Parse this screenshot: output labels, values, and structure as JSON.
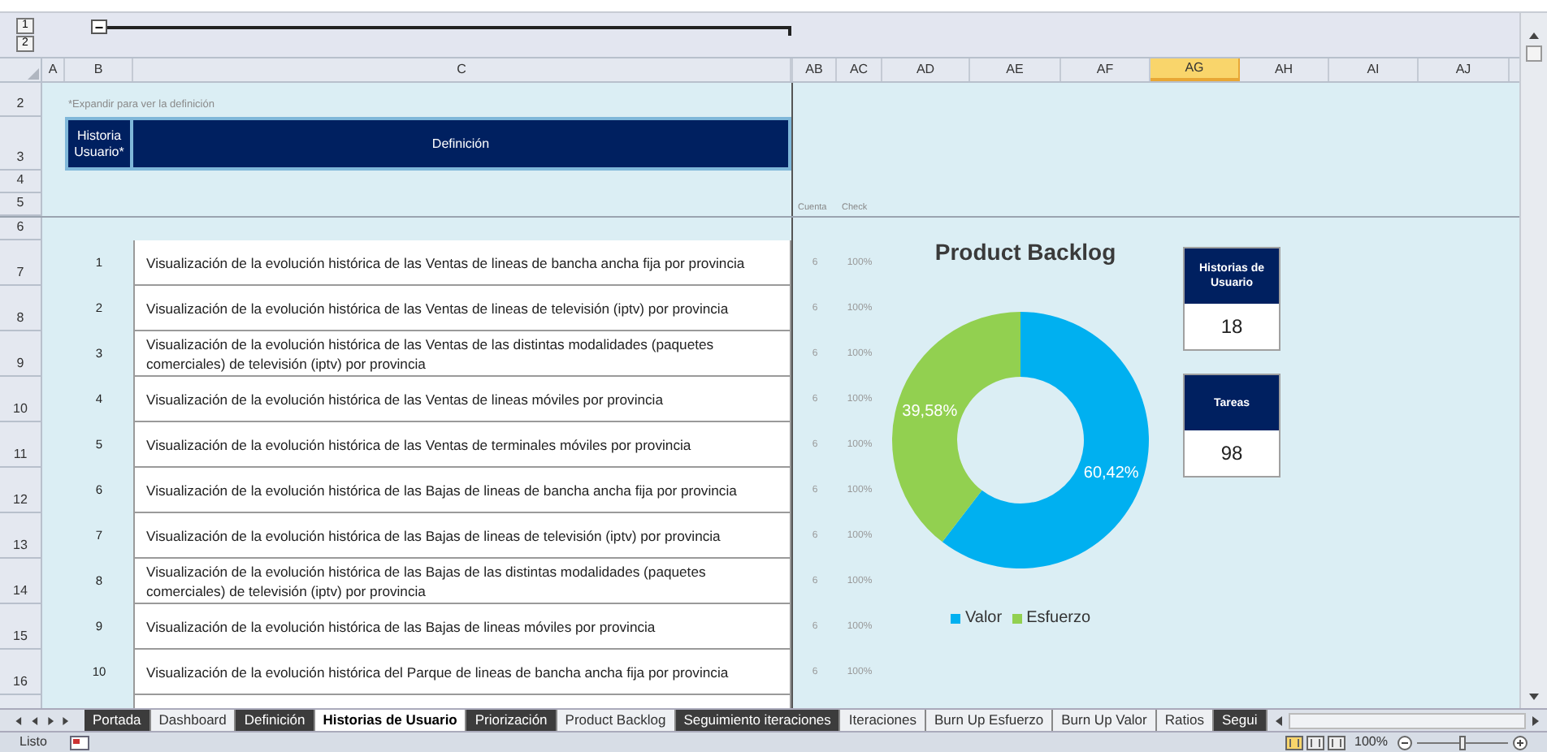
{
  "outline": {
    "levels": [
      "1",
      "2"
    ],
    "collapse": "−"
  },
  "columns": [
    {
      "label": "A",
      "selected": false
    },
    {
      "label": "B",
      "selected": false
    },
    {
      "label": "C",
      "selected": false
    },
    {
      "label": "AB",
      "selected": false
    },
    {
      "label": "AC",
      "selected": false
    },
    {
      "label": "AD",
      "selected": false
    },
    {
      "label": "AE",
      "selected": false
    },
    {
      "label": "AF",
      "selected": false
    },
    {
      "label": "AG",
      "selected": true
    },
    {
      "label": "AH",
      "selected": false
    },
    {
      "label": "AI",
      "selected": false
    },
    {
      "label": "AJ",
      "selected": false
    }
  ],
  "rows": [
    {
      "number": "2",
      "kind": "note",
      "text": "*Expandir para ver la definición"
    },
    {
      "number": "3",
      "kind": "header",
      "id_heading": "Historia Usuario*",
      "definition_heading": "Definición"
    },
    {
      "number": "4",
      "kind": "blank"
    },
    {
      "number": "5",
      "kind": "labels",
      "cuenta": "Cuenta",
      "check": "Check"
    },
    {
      "number": "6",
      "kind": "blank"
    },
    {
      "number": "7",
      "kind": "story",
      "id": "1",
      "definition": "Visualización de la evolución histórica de las Ventas de lineas de bancha ancha fija por provincia",
      "cuenta": "6",
      "check": "100%"
    },
    {
      "number": "8",
      "kind": "story",
      "id": "2",
      "definition": "Visualización de la evolución histórica de las Ventas de lineas de televisión (iptv) por provincia",
      "cuenta": "6",
      "check": "100%"
    },
    {
      "number": "9",
      "kind": "story",
      "id": "3",
      "definition": "Visualización de la evolución histórica de las Ventas de las distintas modalidades (paquetes comerciales) de televisión (iptv) por provincia",
      "cuenta": "6",
      "check": "100%"
    },
    {
      "number": "10",
      "kind": "story",
      "id": "4",
      "definition": "Visualización de la evolución histórica de las Ventas de lineas móviles por provincia",
      "cuenta": "6",
      "check": "100%"
    },
    {
      "number": "11",
      "kind": "story",
      "id": "5",
      "definition": "Visualización de la evolución histórica de las Ventas de terminales móviles por provincia",
      "cuenta": "6",
      "check": "100%"
    },
    {
      "number": "12",
      "kind": "story",
      "id": "6",
      "definition": "Visualización de la evolución histórica de las Bajas de lineas de bancha ancha fija por provincia",
      "cuenta": "6",
      "check": "100%"
    },
    {
      "number": "13",
      "kind": "story",
      "id": "7",
      "definition": "Visualización de la evolución histórica de las Bajas de lineas de televisión (iptv) por provincia",
      "cuenta": "6",
      "check": "100%"
    },
    {
      "number": "14",
      "kind": "story",
      "id": "8",
      "definition": "Visualización de la evolución histórica de las Bajas de las distintas modalidades (paquetes comerciales) de televisión (iptv) por provincia",
      "cuenta": "6",
      "check": "100%"
    },
    {
      "number": "15",
      "kind": "story",
      "id": "9",
      "definition": "Visualización de la evolución histórica de las Bajas de lineas móviles por provincia",
      "cuenta": "6",
      "check": "100%"
    },
    {
      "number": "16",
      "kind": "story",
      "id": "10",
      "definition": "Visualización de la evolución histórica del Parque de lineas de bancha ancha fija por provincia",
      "cuenta": "6",
      "check": "100%"
    }
  ],
  "chart": {
    "chart_data": {
      "type": "donut",
      "title": "Product Backlog",
      "categories": [
        "Valor",
        "Esfuerzo"
      ],
      "values": [
        60.42,
        39.58
      ],
      "colors": [
        "#00b0f0",
        "#92d050"
      ],
      "value_labels": [
        "60,42%",
        "39,58%"
      ],
      "legend": "bottom"
    }
  },
  "kpis": [
    {
      "label": "Historias de Usuario",
      "value": "18"
    },
    {
      "label": "Tareas",
      "value": "98"
    }
  ],
  "sheet_tabs": [
    {
      "label": "Portada",
      "dark": true,
      "selected": false
    },
    {
      "label": "Dashboard",
      "dark": false,
      "selected": false
    },
    {
      "label": "Definición",
      "dark": true,
      "selected": false
    },
    {
      "label": "Historias de Usuario",
      "selected": true
    },
    {
      "label": "Priorización",
      "dark": true,
      "selected": false
    },
    {
      "label": "Product Backlog",
      "dark": false,
      "selected": false
    },
    {
      "label": "Seguimiento iteraciones",
      "dark": true,
      "selected": false
    },
    {
      "label": "Iteraciones",
      "dark": false,
      "selected": false
    },
    {
      "label": "Burn Up Esfuerzo",
      "dark": false,
      "selected": false
    },
    {
      "label": "Burn Up Valor",
      "dark": false,
      "selected": false
    },
    {
      "label": "Ratios",
      "dark": false,
      "selected": false
    },
    {
      "label": "Segui",
      "dark": true,
      "selected": false
    }
  ],
  "status_bar": {
    "status": "Listo",
    "zoom": "100%",
    "zoom_slider": {
      "level": 0.5
    }
  }
}
